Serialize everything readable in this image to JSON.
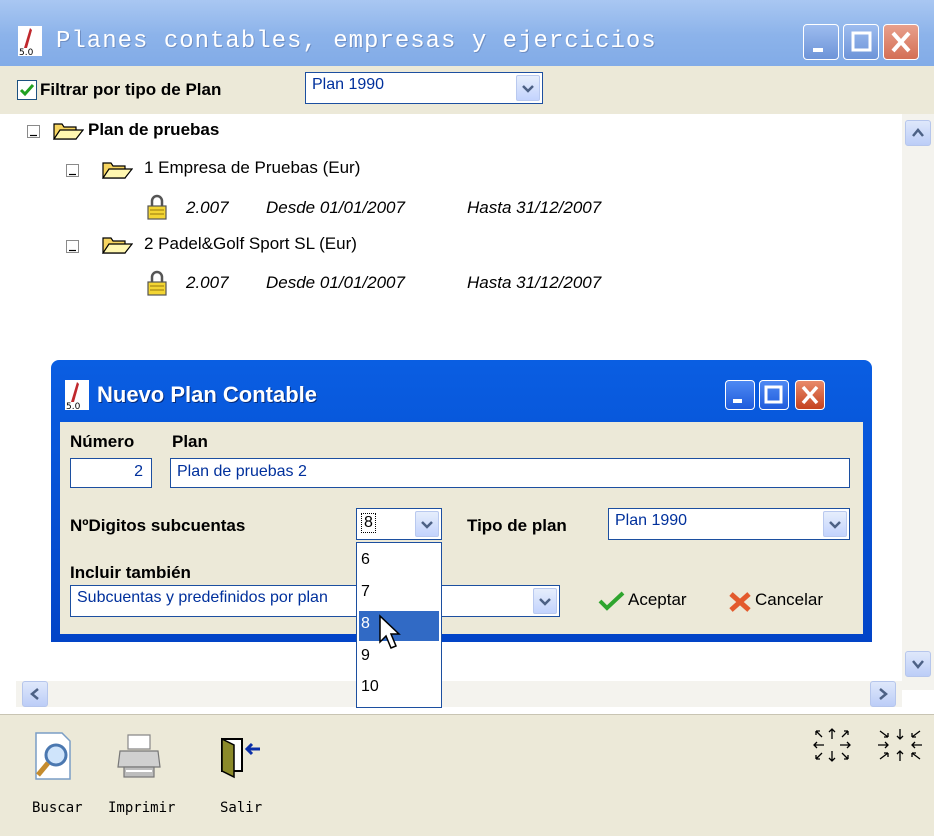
{
  "main_window": {
    "title": "Planes contables, empresas y ejercicios",
    "filter": {
      "label": "Filtrar por tipo de Plan",
      "checked": true,
      "selected": "Plan 1990"
    },
    "tree": {
      "root": "Plan de pruebas",
      "companies": [
        {
          "label": "1 Empresa de Pruebas (Eur)",
          "year": "2.007",
          "from": "Desde 01/01/2007",
          "to": "Hasta 31/12/2007"
        },
        {
          "label": "2 Padel&Golf Sport SL (Eur)",
          "year": "2.007",
          "from": "Desde 01/01/2007",
          "to": "Hasta 31/12/2007"
        }
      ]
    },
    "toolbar": {
      "buscar": "Buscar",
      "imprimir": "Imprimir",
      "salir": "Salir"
    }
  },
  "dialog": {
    "title": "Nuevo Plan Contable",
    "numero_label": "Número",
    "plan_label": "Plan",
    "numero": "2",
    "plan": "Plan de pruebas 2",
    "digitos_label": "NºDigitos subcuentas",
    "digitos_selected": "8",
    "digitos_options": [
      "6",
      "7",
      "8",
      "9",
      "10"
    ],
    "tipo_label": "Tipo de plan",
    "tipo_selected": "Plan 1990",
    "incluir_label": "Incluir también",
    "incluir_selected": "Subcuentas y predefinidos por plan",
    "aceptar": "Aceptar",
    "cancelar": "Cancelar"
  }
}
